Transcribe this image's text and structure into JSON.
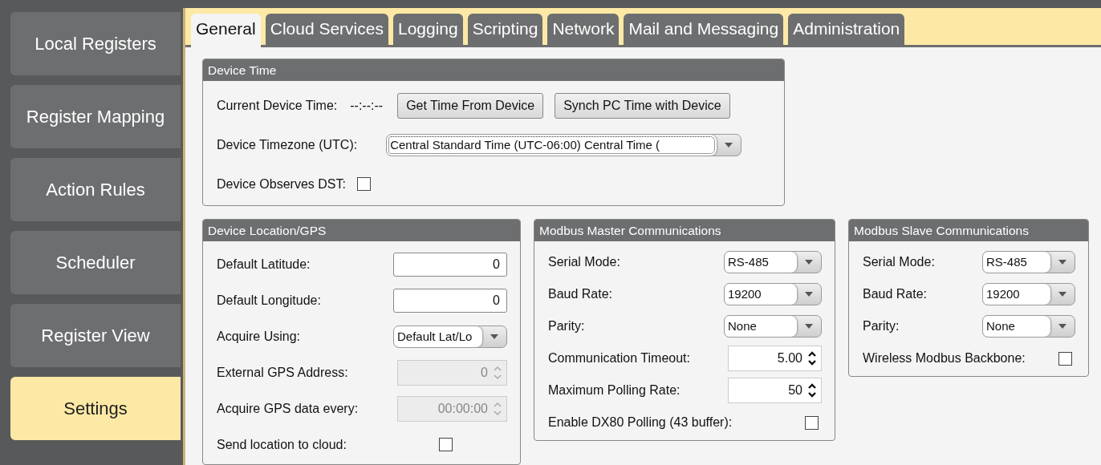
{
  "sidebar": {
    "items": [
      {
        "label": "Local Registers",
        "selected": false
      },
      {
        "label": "Register Mapping",
        "selected": false
      },
      {
        "label": "Action Rules",
        "selected": false
      },
      {
        "label": "Scheduler",
        "selected": false
      },
      {
        "label": "Register View",
        "selected": false
      },
      {
        "label": "Settings",
        "selected": true
      }
    ]
  },
  "tabs": [
    {
      "label": "General",
      "selected": true
    },
    {
      "label": "Cloud Services",
      "selected": false
    },
    {
      "label": "Logging",
      "selected": false
    },
    {
      "label": "Scripting",
      "selected": false
    },
    {
      "label": "Network",
      "selected": false
    },
    {
      "label": "Mail and Messaging",
      "selected": false
    },
    {
      "label": "Administration",
      "selected": false
    }
  ],
  "panels": [
    {
      "title": "Device Time",
      "rows": [
        {
          "kind": "time",
          "label": "Current Device Time:",
          "value": "--:--:--",
          "buttons": [
            "Get Time From Device",
            "Synch PC Time with Device"
          ]
        },
        {
          "kind": "select",
          "label": "Device Timezone (UTC):",
          "value": "Central Standard Time (UTC-06:00) Central Time ("
        },
        {
          "kind": "checkbox",
          "label": "Device Observes DST:",
          "checked": false
        }
      ]
    },
    {
      "title": "Device Location/GPS",
      "rows": [
        {
          "kind": "number",
          "label": "Default Latitude:",
          "value": "0"
        },
        {
          "kind": "number",
          "label": "Default Longitude:",
          "value": "0"
        },
        {
          "kind": "select",
          "label": "Acquire Using:",
          "value": "Default Lat/Lo"
        },
        {
          "kind": "spinner",
          "label": "External GPS Address:",
          "value": "0",
          "disabled": true
        },
        {
          "kind": "spinner",
          "label": "Acquire GPS data every:",
          "value": "00:00:00",
          "disabled": true
        },
        {
          "kind": "checkbox",
          "label": "Send location to cloud:",
          "checked": false
        }
      ]
    },
    {
      "title": "Modbus Master Communications",
      "rows": [
        {
          "kind": "select",
          "label": "Serial Mode:",
          "value": "RS-485"
        },
        {
          "kind": "select",
          "label": "Baud Rate:",
          "value": "19200"
        },
        {
          "kind": "select",
          "label": "Parity:",
          "value": "None"
        },
        {
          "kind": "spinner",
          "label": "Communication Timeout:",
          "value": "5.00",
          "disabled": false
        },
        {
          "kind": "spinner",
          "label": "Maximum Polling Rate:",
          "value": "50",
          "disabled": false
        },
        {
          "kind": "checkbox",
          "label": "Enable DX80 Polling (43 buffer):",
          "checked": false
        }
      ]
    },
    {
      "title": "Modbus Slave Communications",
      "rows": [
        {
          "kind": "select",
          "label": "Serial Mode:",
          "value": "RS-485"
        },
        {
          "kind": "select",
          "label": "Baud Rate:",
          "value": "19200"
        },
        {
          "kind": "select",
          "label": "Parity:",
          "value": "None"
        },
        {
          "kind": "checkbox",
          "label": "Wireless Modbus Backbone:",
          "checked": false
        }
      ]
    }
  ]
}
